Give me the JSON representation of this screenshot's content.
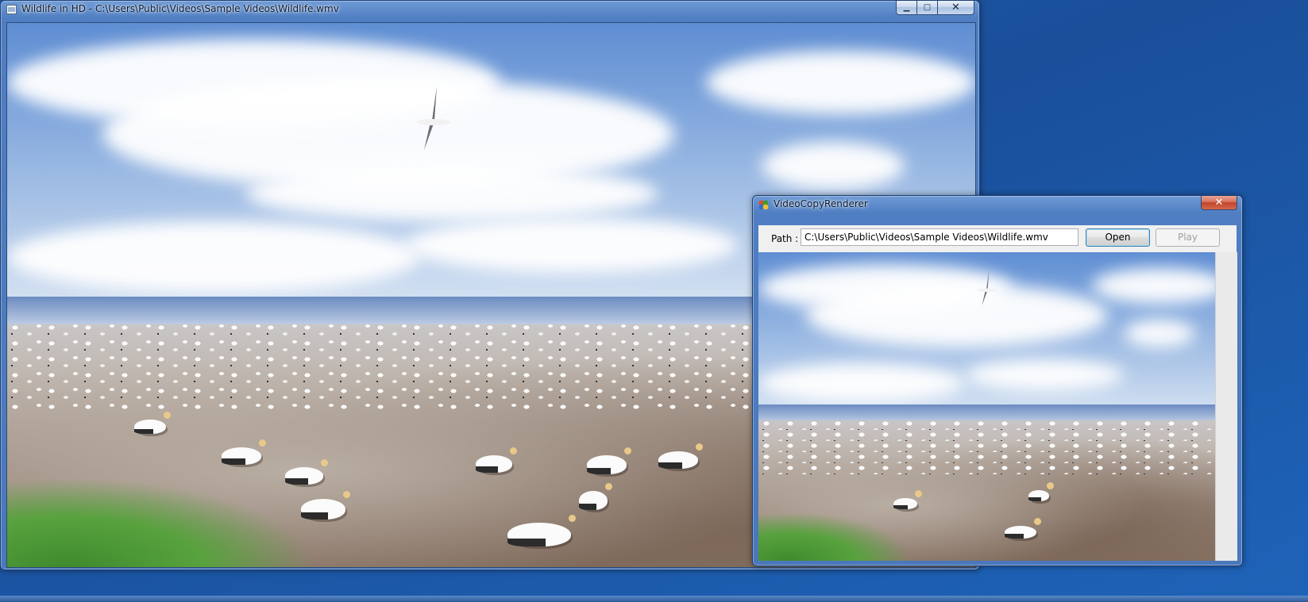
{
  "main_window": {
    "title": "Wildlife in HD - C:\\Users\\Public\\Videos\\Sample Videos\\Wildlife.wmv"
  },
  "app_window": {
    "title": "VideoCopyRenderer",
    "path_label": "Path :",
    "path_value": "C:\\Users\\Public\\Videos\\Sample Videos\\Wildlife.wmv",
    "open_label": "Open",
    "play_label": "Play",
    "play_enabled": false
  },
  "caption": {
    "minimize_glyph": "▁",
    "maximize_glyph": "□",
    "close_glyph": "✕"
  },
  "colors": {
    "desktop": "#1f5fb0",
    "titlebar": "#4f7ec2",
    "close_active": "#c1432a"
  }
}
